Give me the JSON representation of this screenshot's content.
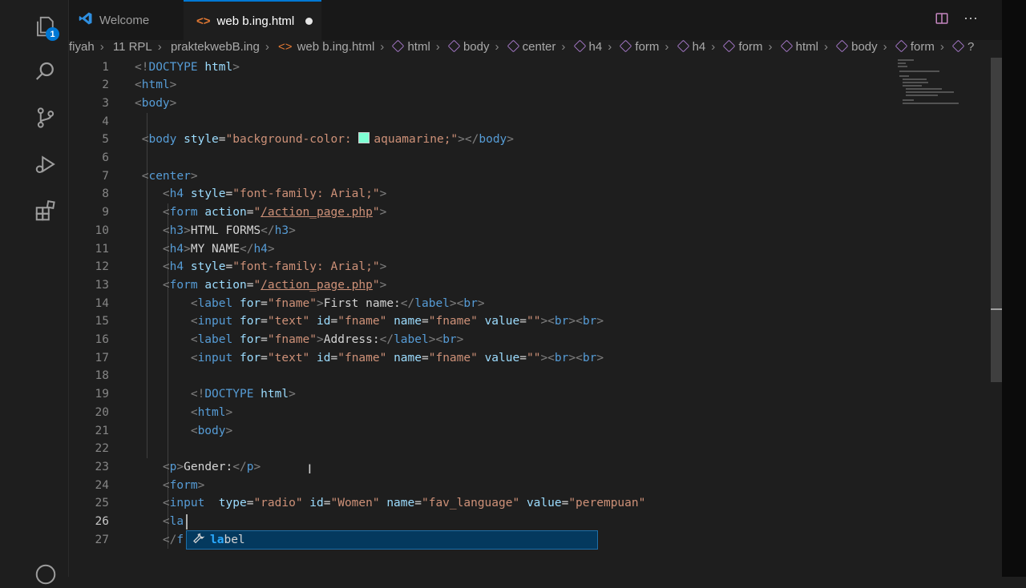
{
  "tabs": [
    {
      "label": "Welcome",
      "icon": "vscode-logo-icon"
    },
    {
      "label": "web b.ing.html",
      "icon": "html-file-icon",
      "dirty": true
    }
  ],
  "activity": {
    "source_control_badge": "1"
  },
  "breadcrumbs": [
    "fiyah",
    "11 RPL",
    "praktekwebB.ing",
    "web b.ing.html",
    "html",
    "body",
    "center",
    "h4",
    "form",
    "h4",
    "form",
    "html",
    "body",
    "form",
    "?"
  ],
  "editor": {
    "active_line": 26,
    "lines": [
      {
        "n": "1",
        "t": [
          [
            "tg",
            "<!"
          ],
          [
            "tn",
            "DOCTYPE"
          ],
          [
            "tx",
            " "
          ],
          [
            "at",
            "html"
          ],
          [
            "tg",
            ">"
          ]
        ]
      },
      {
        "n": "2",
        "t": [
          [
            "tg",
            "<"
          ],
          [
            "tn",
            "html"
          ],
          [
            "tg",
            ">"
          ]
        ]
      },
      {
        "n": "3",
        "t": [
          [
            "tg",
            "<"
          ],
          [
            "tn",
            "body"
          ],
          [
            "tg",
            ">"
          ]
        ]
      },
      {
        "n": "4",
        "t": []
      },
      {
        "n": "5",
        "t": [
          [
            "tx",
            " "
          ],
          [
            "tg",
            "<"
          ],
          [
            "tn",
            "body"
          ],
          [
            "tx",
            " "
          ],
          [
            "at",
            "style"
          ],
          [
            "tx",
            "="
          ],
          [
            "st",
            "\"background-color: "
          ],
          [
            "sw",
            ""
          ],
          [
            "st",
            "aquamarine;\""
          ],
          [
            "tg",
            "></"
          ],
          [
            "tn",
            "body"
          ],
          [
            "tg",
            ">"
          ]
        ]
      },
      {
        "n": "6",
        "t": []
      },
      {
        "n": "7",
        "t": [
          [
            "tx",
            " "
          ],
          [
            "tg",
            "<"
          ],
          [
            "tn",
            "center"
          ],
          [
            "tg",
            ">"
          ]
        ]
      },
      {
        "n": "8",
        "t": [
          [
            "tx",
            "    "
          ],
          [
            "tg",
            "<"
          ],
          [
            "tn",
            "h4"
          ],
          [
            "tx",
            " "
          ],
          [
            "at",
            "style"
          ],
          [
            "tx",
            "="
          ],
          [
            "st",
            "\"font-family: Arial;\""
          ],
          [
            "tg",
            ">"
          ]
        ]
      },
      {
        "n": "9",
        "t": [
          [
            "tx",
            "    "
          ],
          [
            "tg",
            "<"
          ],
          [
            "tn",
            "form"
          ],
          [
            "tx",
            " "
          ],
          [
            "at",
            "action"
          ],
          [
            "tx",
            "="
          ],
          [
            "st",
            "\""
          ],
          [
            "stl",
            "/action_page.php"
          ],
          [
            "st",
            "\""
          ],
          [
            "tg",
            ">"
          ]
        ]
      },
      {
        "n": "10",
        "t": [
          [
            "tx",
            "    "
          ],
          [
            "tg",
            "<"
          ],
          [
            "tn",
            "h3"
          ],
          [
            "tg",
            ">"
          ],
          [
            "tx",
            "HTML FORMS"
          ],
          [
            "tg",
            "</"
          ],
          [
            "tn",
            "h3"
          ],
          [
            "tg",
            ">"
          ]
        ]
      },
      {
        "n": "11",
        "t": [
          [
            "tx",
            "    "
          ],
          [
            "tg",
            "<"
          ],
          [
            "tn",
            "h4"
          ],
          [
            "tg",
            ">"
          ],
          [
            "tx",
            "MY NAME"
          ],
          [
            "tg",
            "</"
          ],
          [
            "tn",
            "h4"
          ],
          [
            "tg",
            ">"
          ]
        ]
      },
      {
        "n": "12",
        "t": [
          [
            "tx",
            "    "
          ],
          [
            "tg",
            "<"
          ],
          [
            "tn",
            "h4"
          ],
          [
            "tx",
            " "
          ],
          [
            "at",
            "style"
          ],
          [
            "tx",
            "="
          ],
          [
            "st",
            "\"font-family: Arial;\""
          ],
          [
            "tg",
            ">"
          ]
        ]
      },
      {
        "n": "13",
        "t": [
          [
            "tx",
            "    "
          ],
          [
            "tg",
            "<"
          ],
          [
            "tn",
            "form"
          ],
          [
            "tx",
            " "
          ],
          [
            "at",
            "action"
          ],
          [
            "tx",
            "="
          ],
          [
            "st",
            "\""
          ],
          [
            "stl",
            "/action_page.php"
          ],
          [
            "st",
            "\""
          ],
          [
            "tg",
            ">"
          ]
        ]
      },
      {
        "n": "14",
        "t": [
          [
            "tx",
            "        "
          ],
          [
            "tg",
            "<"
          ],
          [
            "tn",
            "label"
          ],
          [
            "tx",
            " "
          ],
          [
            "at",
            "for"
          ],
          [
            "tx",
            "="
          ],
          [
            "st",
            "\"fname\""
          ],
          [
            "tg",
            ">"
          ],
          [
            "tx",
            "First name:"
          ],
          [
            "tg",
            "</"
          ],
          [
            "tn",
            "label"
          ],
          [
            "tg",
            "><"
          ],
          [
            "tn",
            "br"
          ],
          [
            "tg",
            ">"
          ]
        ]
      },
      {
        "n": "15",
        "t": [
          [
            "tx",
            "        "
          ],
          [
            "tg",
            "<"
          ],
          [
            "tn",
            "input"
          ],
          [
            "tx",
            " "
          ],
          [
            "at",
            "for"
          ],
          [
            "tx",
            "="
          ],
          [
            "st",
            "\"text\""
          ],
          [
            "tx",
            " "
          ],
          [
            "at",
            "id"
          ],
          [
            "tx",
            "="
          ],
          [
            "st",
            "\"fname\""
          ],
          [
            "tx",
            " "
          ],
          [
            "at",
            "name"
          ],
          [
            "tx",
            "="
          ],
          [
            "st",
            "\"fname\""
          ],
          [
            "tx",
            " "
          ],
          [
            "at",
            "value"
          ],
          [
            "tx",
            "="
          ],
          [
            "st",
            "\"\""
          ],
          [
            "tg",
            "><"
          ],
          [
            "tn",
            "br"
          ],
          [
            "tg",
            "><"
          ],
          [
            "tn",
            "br"
          ],
          [
            "tg",
            ">"
          ]
        ]
      },
      {
        "n": "16",
        "t": [
          [
            "tx",
            "        "
          ],
          [
            "tg",
            "<"
          ],
          [
            "tn",
            "label"
          ],
          [
            "tx",
            " "
          ],
          [
            "at",
            "for"
          ],
          [
            "tx",
            "="
          ],
          [
            "st",
            "\"fname\""
          ],
          [
            "tg",
            ">"
          ],
          [
            "tx",
            "Address:"
          ],
          [
            "tg",
            "</"
          ],
          [
            "tn",
            "label"
          ],
          [
            "tg",
            "><"
          ],
          [
            "tn",
            "br"
          ],
          [
            "tg",
            ">"
          ]
        ]
      },
      {
        "n": "17",
        "t": [
          [
            "tx",
            "        "
          ],
          [
            "tg",
            "<"
          ],
          [
            "tn",
            "input"
          ],
          [
            "tx",
            " "
          ],
          [
            "at",
            "for"
          ],
          [
            "tx",
            "="
          ],
          [
            "st",
            "\"text\""
          ],
          [
            "tx",
            " "
          ],
          [
            "at",
            "id"
          ],
          [
            "tx",
            "="
          ],
          [
            "st",
            "\"fname\""
          ],
          [
            "tx",
            " "
          ],
          [
            "at",
            "name"
          ],
          [
            "tx",
            "="
          ],
          [
            "st",
            "\"fname\""
          ],
          [
            "tx",
            " "
          ],
          [
            "at",
            "value"
          ],
          [
            "tx",
            "="
          ],
          [
            "st",
            "\"\""
          ],
          [
            "tg",
            "><"
          ],
          [
            "tn",
            "br"
          ],
          [
            "tg",
            "><"
          ],
          [
            "tn",
            "br"
          ],
          [
            "tg",
            ">"
          ]
        ]
      },
      {
        "n": "18",
        "t": []
      },
      {
        "n": "19",
        "t": [
          [
            "tx",
            "        "
          ],
          [
            "tg",
            "<!"
          ],
          [
            "tn",
            "DOCTYPE"
          ],
          [
            "tx",
            " "
          ],
          [
            "at",
            "html"
          ],
          [
            "tg",
            ">"
          ]
        ]
      },
      {
        "n": "20",
        "t": [
          [
            "tx",
            "        "
          ],
          [
            "tg",
            "<"
          ],
          [
            "tn",
            "html"
          ],
          [
            "tg",
            ">"
          ]
        ]
      },
      {
        "n": "21",
        "t": [
          [
            "tx",
            "        "
          ],
          [
            "tg",
            "<"
          ],
          [
            "tn",
            "body"
          ],
          [
            "tg",
            ">"
          ]
        ]
      },
      {
        "n": "22",
        "t": []
      },
      {
        "n": "23",
        "t": [
          [
            "tx",
            "    "
          ],
          [
            "tg",
            "<"
          ],
          [
            "tn",
            "p"
          ],
          [
            "tg",
            ">"
          ],
          [
            "tx",
            "Gender:"
          ],
          [
            "tg",
            "</"
          ],
          [
            "tn",
            "p"
          ],
          [
            "tg",
            ">"
          ]
        ]
      },
      {
        "n": "24",
        "t": [
          [
            "tx",
            "    "
          ],
          [
            "tg",
            "<"
          ],
          [
            "tn",
            "form"
          ],
          [
            "tg",
            ">"
          ]
        ]
      },
      {
        "n": "25",
        "t": [
          [
            "tx",
            "    "
          ],
          [
            "tg",
            "<"
          ],
          [
            "tn",
            "input"
          ],
          [
            "tx",
            "  "
          ],
          [
            "at",
            "type"
          ],
          [
            "tx",
            "="
          ],
          [
            "st",
            "\"radio\""
          ],
          [
            "tx",
            " "
          ],
          [
            "at",
            "id"
          ],
          [
            "tx",
            "="
          ],
          [
            "st",
            "\"Women\""
          ],
          [
            "tx",
            " "
          ],
          [
            "at",
            "name"
          ],
          [
            "tx",
            "="
          ],
          [
            "st",
            "\"fav_language\""
          ],
          [
            "tx",
            " "
          ],
          [
            "at",
            "value"
          ],
          [
            "tx",
            "="
          ],
          [
            "st",
            "\"perempuan\""
          ]
        ]
      },
      {
        "n": "26",
        "t": [
          [
            "tx",
            "    "
          ],
          [
            "tg",
            "<"
          ],
          [
            "tn",
            "la"
          ]
        ]
      },
      {
        "n": "27",
        "t": [
          [
            "tx",
            "    "
          ],
          [
            "tg",
            "</"
          ],
          [
            "tn",
            "f"
          ]
        ]
      }
    ]
  },
  "suggestion": {
    "match": "la",
    "rest": "bel"
  },
  "colors": {
    "accent": "#0078d4",
    "swatch": "#7fffd4"
  }
}
